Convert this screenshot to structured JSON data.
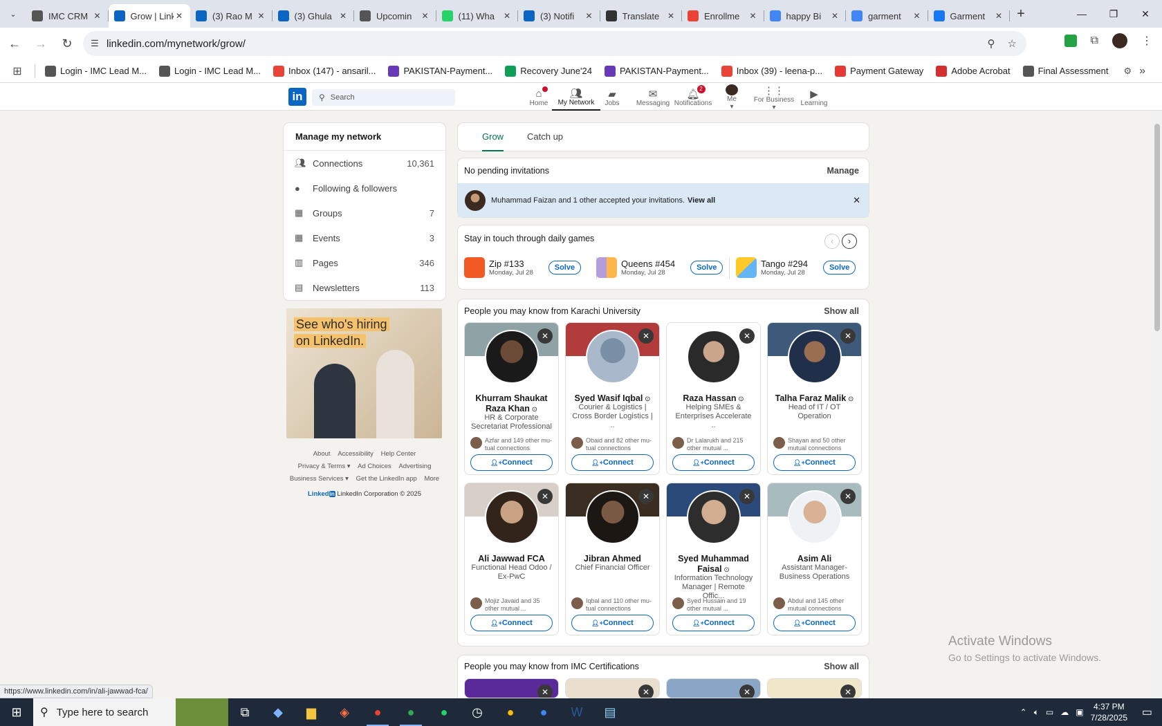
{
  "browser": {
    "tabs": [
      {
        "label": "IMC CRM",
        "icon": "imc-icon",
        "color": "#555"
      },
      {
        "label": "Grow | LinkedIn",
        "icon": "linkedin-icon",
        "color": "#0a66c2",
        "active": true
      },
      {
        "label": "(3) Rao M",
        "icon": "linkedin-icon",
        "color": "#0a66c2"
      },
      {
        "label": "(3) Ghula",
        "icon": "linkedin-icon",
        "color": "#0a66c2"
      },
      {
        "label": "Upcomin",
        "icon": "imc-icon",
        "color": "#555"
      },
      {
        "label": "(11) Wha",
        "icon": "whatsapp-icon",
        "color": "#25d366"
      },
      {
        "label": "(3) Notifi",
        "icon": "linkedin-icon",
        "color": "#0a66c2"
      },
      {
        "label": "Translate",
        "icon": "openai-icon",
        "color": "#333"
      },
      {
        "label": "Enrollme",
        "icon": "gmail-icon",
        "color": "#ea4335"
      },
      {
        "label": "happy Bi",
        "icon": "google-icon",
        "color": "#4285f4"
      },
      {
        "label": "garment",
        "icon": "google-icon",
        "color": "#4285f4"
      },
      {
        "label": "Garment",
        "icon": "facebook-icon",
        "color": "#1877f2"
      }
    ],
    "url": "linkedin.com/mynetwork/grow/",
    "bookmarks": [
      {
        "label": "Login - IMC Lead M...",
        "icon": "imc-icon",
        "color": "#555"
      },
      {
        "label": "Login - IMC Lead M...",
        "icon": "imc-icon",
        "color": "#555"
      },
      {
        "label": "Inbox (147) - ansaril...",
        "icon": "gmail-icon",
        "color": "#ea4335"
      },
      {
        "label": "PAKISTAN-Payment...",
        "icon": "forms-icon",
        "color": "#673ab7"
      },
      {
        "label": "Recovery June'24",
        "icon": "sheets-icon",
        "color": "#0f9d58"
      },
      {
        "label": "PAKISTAN-Payment...",
        "icon": "forms-icon",
        "color": "#673ab7"
      },
      {
        "label": "Inbox (39) - leena-p...",
        "icon": "gmail-icon",
        "color": "#ea4335"
      },
      {
        "label": "Payment Gateway",
        "icon": "gateway-icon",
        "color": "#e53935"
      },
      {
        "label": "Adobe Acrobat",
        "icon": "acrobat-icon",
        "color": "#d32f2f"
      },
      {
        "label": "Final Assessment",
        "icon": "imc-icon",
        "color": "#555"
      }
    ],
    "status_url": "https://www.linkedin.com/in/ali-jawwad-fca/"
  },
  "linkedin": {
    "search_placeholder": "Search",
    "nav": [
      {
        "label": "Home",
        "icon": "home-icon",
        "badge": ""
      },
      {
        "label": "My Network",
        "icon": "network-icon",
        "active": true
      },
      {
        "label": "Jobs",
        "icon": "jobs-icon"
      },
      {
        "label": "Messaging",
        "icon": "messaging-icon"
      },
      {
        "label": "Notifications",
        "icon": "bell-icon",
        "badge": "2"
      },
      {
        "label": "Me",
        "icon": "avatar-icon"
      },
      {
        "label": "For Business",
        "icon": "grid-icon"
      },
      {
        "label": "Learning",
        "icon": "learning-icon"
      }
    ],
    "sidebar": {
      "title": "Manage my network",
      "items": [
        {
          "label": "Connections",
          "count": "10,361",
          "icon": "people-icon"
        },
        {
          "label": "Following & followers",
          "count": "",
          "icon": "person-icon"
        },
        {
          "label": "Groups",
          "count": "7",
          "icon": "groups-icon"
        },
        {
          "label": "Events",
          "count": "3",
          "icon": "calendar-icon"
        },
        {
          "label": "Pages",
          "count": "346",
          "icon": "pages-icon"
        },
        {
          "label": "Newsletters",
          "count": "113",
          "icon": "newsletter-icon"
        }
      ]
    },
    "ad": {
      "line1": "See who's hiring",
      "line2": "on LinkedIn."
    },
    "footer": {
      "links": [
        "About",
        "Accessibility",
        "Help Center",
        "Privacy & Terms",
        "Ad Choices",
        "Advertising",
        "Business Services",
        "Get the LinkedIn app",
        "More"
      ],
      "brand": "Linked",
      "copyright": "LinkedIn Corporation © 2025"
    },
    "grow_tabs": {
      "grow": "Grow",
      "catch_up": "Catch up"
    },
    "invitations": {
      "text": "No pending invitations",
      "manage": "Manage",
      "banner": "Muhammad Faizan and 1 other accepted your invitations.",
      "view_all": "View all"
    },
    "games": {
      "title": "Stay in touch through daily games",
      "items": [
        {
          "name": "Zip #133",
          "date": "Monday, Jul 28",
          "action": "Solve"
        },
        {
          "name": "Queens #454",
          "date": "Monday, Jul 28",
          "action": "Solve"
        },
        {
          "name": "Tango #294",
          "date": "Monday, Jul 28",
          "action": "Solve"
        }
      ]
    },
    "pymk_karachi": {
      "title": "People you may know from Karachi University",
      "show_all": "Show all",
      "people": [
        {
          "name": "Khurram Shaukat Raza Khan",
          "headline": "HR & Corporate Secretariat Professional",
          "mutual": "Azfar and 149 other mu- tual connections",
          "action": "Connect"
        },
        {
          "name": "Syed Wasif Iqbal",
          "headline": "Courier & Logistics | Cross Border Logistics | ..",
          "mutual": "Obaid and 82 other mu- tual connections",
          "action": "Connect"
        },
        {
          "name": "Raza Hassan",
          "headline": "Helping SMEs & Enterprises Accelerate ..",
          "mutual": "Dr Lalarukh and 215 other mutual ...",
          "action": "Connect"
        },
        {
          "name": "Talha Faraz Malik",
          "headline": "Head of IT / OT Operation",
          "mutual": "Shayan and 50 other mutual connections",
          "action": "Connect"
        },
        {
          "name": "Ali Jawwad FCA",
          "headline": "Functional Head Odoo / Ex-PwC",
          "mutual": "Mojiz Javaid and 35 other mutual ...",
          "action": "Connect"
        },
        {
          "name": "Jibran Ahmed",
          "headline": "Chief Financial Officer",
          "mutual": "Iqbal and 110 other mu- tual connections",
          "action": "Connect"
        },
        {
          "name": "Syed Muhammad Faisal",
          "headline": "Information Technology Manager | Remote Offic...",
          "mutual": "Syed Hussain and 19 other mutual ...",
          "action": "Connect"
        },
        {
          "name": "Asim Ali",
          "headline": "Assistant Manager- Business Operations",
          "mutual": "Abdul and 145 other mutual connections",
          "action": "Connect"
        }
      ]
    },
    "pymk_imc": {
      "title": "People you may know from IMC Certifications",
      "show_all": "Show all"
    }
  },
  "windows": {
    "watermark_line1": "Activate Windows",
    "watermark_line2": "Go to Settings to activate Windows.",
    "search_placeholder": "Type here to search",
    "time": "4:37 PM",
    "date": "7/28/2025"
  }
}
